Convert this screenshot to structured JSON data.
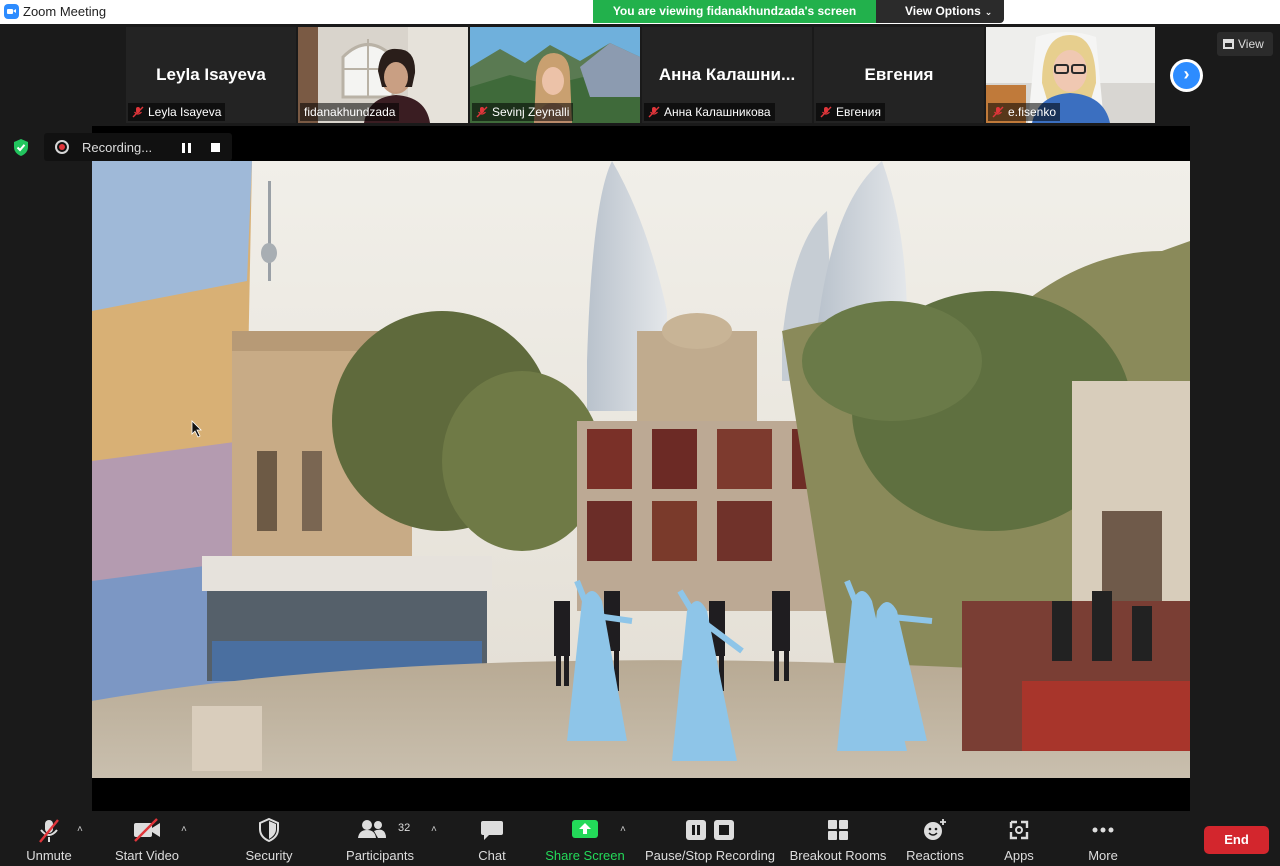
{
  "window": {
    "title": "Zoom Meeting"
  },
  "share_banner": {
    "text": "You are viewing fidanakhundzada's screen"
  },
  "view_options": {
    "label": "View Options"
  },
  "view_button": {
    "label": "View"
  },
  "recording": {
    "status": "Recording..."
  },
  "participants": [
    {
      "big_name": "Leyla Isayeva",
      "name": "Leyla Isayeva",
      "video": false,
      "muted": true
    },
    {
      "big_name": "",
      "name": "fidanakhundzada",
      "video": true,
      "muted": false,
      "active_speaker": true
    },
    {
      "big_name": "",
      "name": "Sevinj Zeynalli",
      "video": true,
      "muted": true
    },
    {
      "big_name": "Анна  Калашни...",
      "name": "Анна Калашникова",
      "video": false,
      "muted": true
    },
    {
      "big_name": "Евгения",
      "name": "Евгения",
      "video": false,
      "muted": true
    },
    {
      "big_name": "",
      "name": "e.fisenko",
      "video": true,
      "muted": true
    }
  ],
  "toolbar": {
    "unmute": "Unmute",
    "start_video": "Start Video",
    "security": "Security",
    "participants": "Participants",
    "participants_count": "32",
    "chat": "Chat",
    "share_screen": "Share Screen",
    "pause_stop_recording": "Pause/Stop Recording",
    "breakout_rooms": "Breakout Rooms",
    "reactions": "Reactions",
    "apps": "Apps",
    "more": "More",
    "end": "End"
  },
  "colors": {
    "share_banner_bg": "#22b14c",
    "accent_blue": "#2d8cff",
    "end_red": "#d3262d",
    "share_screen_green": "#23d959",
    "mute_red": "#e0353a"
  }
}
